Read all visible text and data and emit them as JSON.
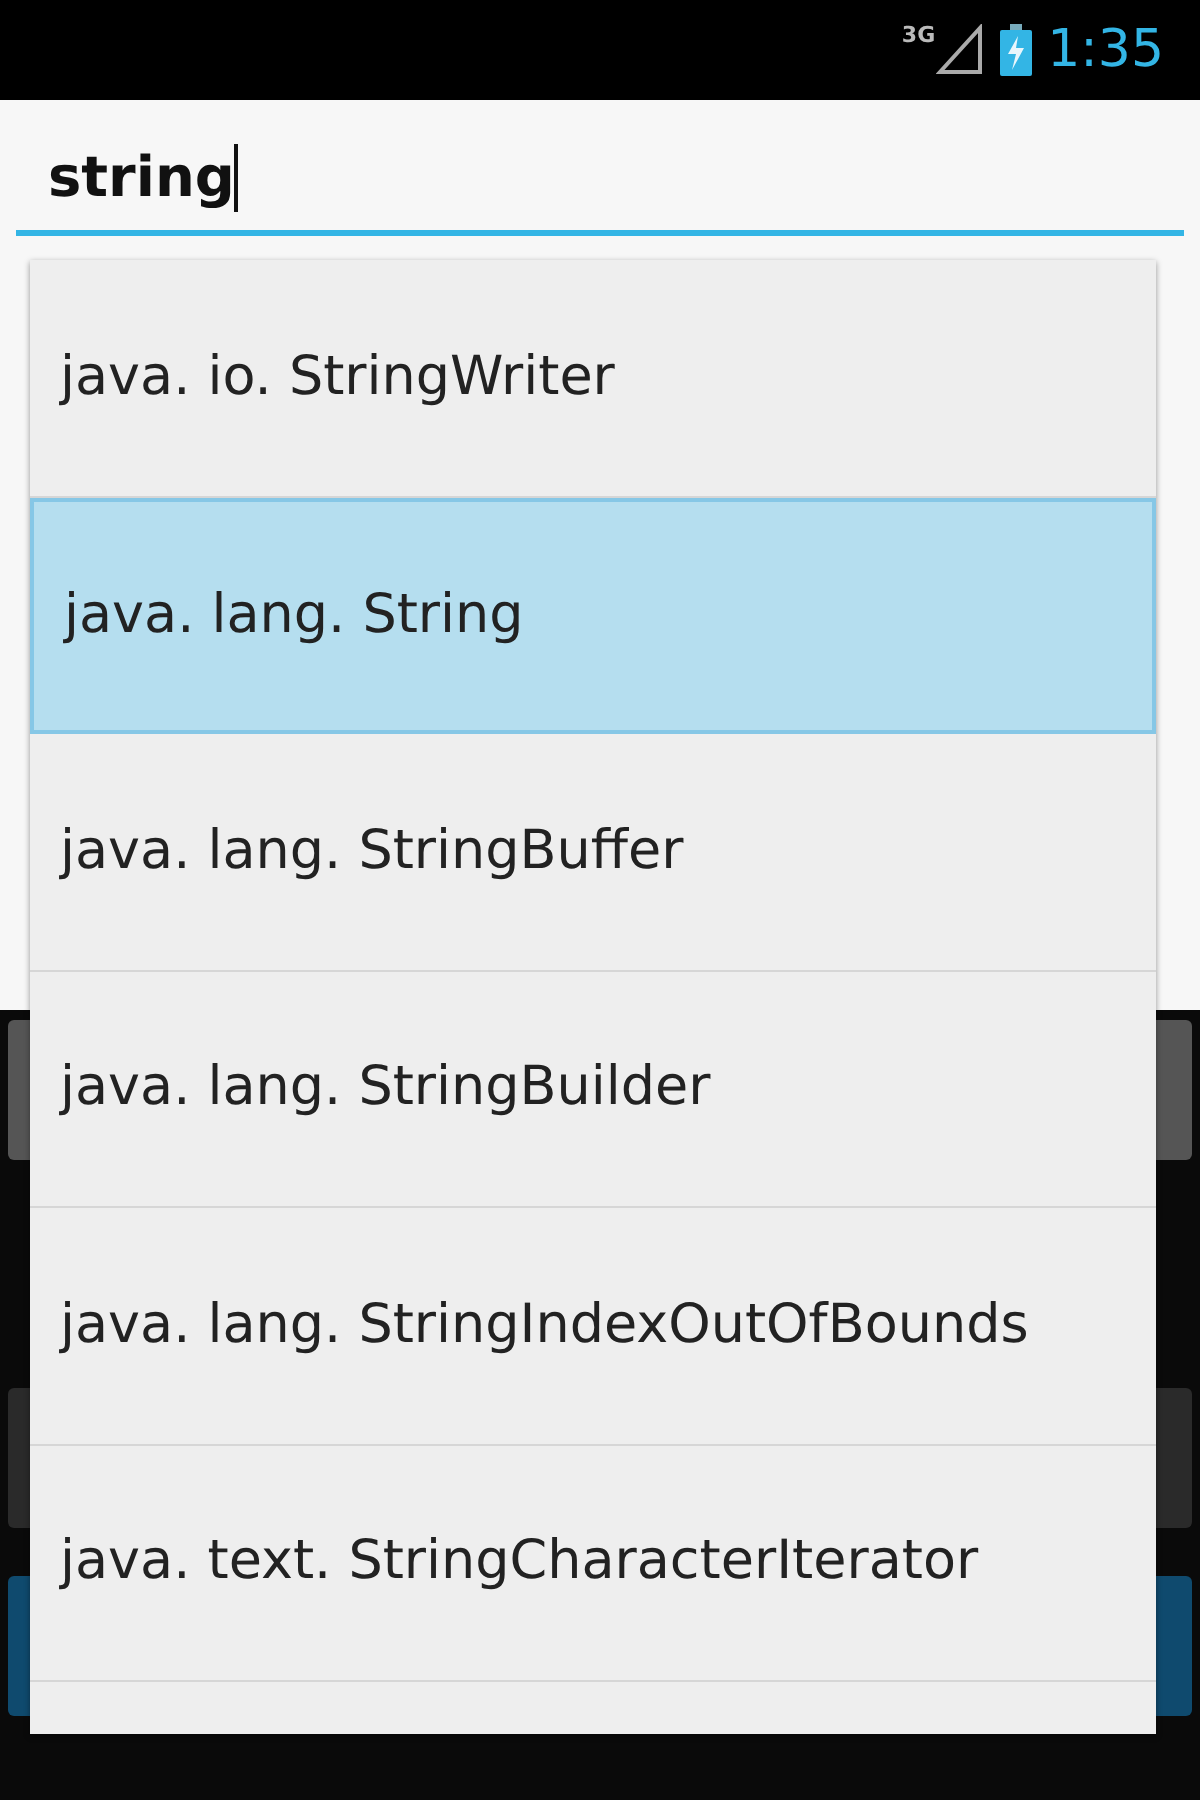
{
  "status_bar": {
    "network": "3G",
    "time": "1:35"
  },
  "search": {
    "value": "string"
  },
  "suggestions": [
    {
      "label": "java. io. StringWriter",
      "selected": false
    },
    {
      "label": "java. lang. String",
      "selected": true
    },
    {
      "label": "java. lang. StringBuffer",
      "selected": false
    },
    {
      "label": "java. lang. StringBuilder",
      "selected": false
    },
    {
      "label": "java. lang. StringIndexOutOfBounds",
      "selected": false
    },
    {
      "label": "java. text. StringCharacterIterator",
      "selected": false
    }
  ]
}
